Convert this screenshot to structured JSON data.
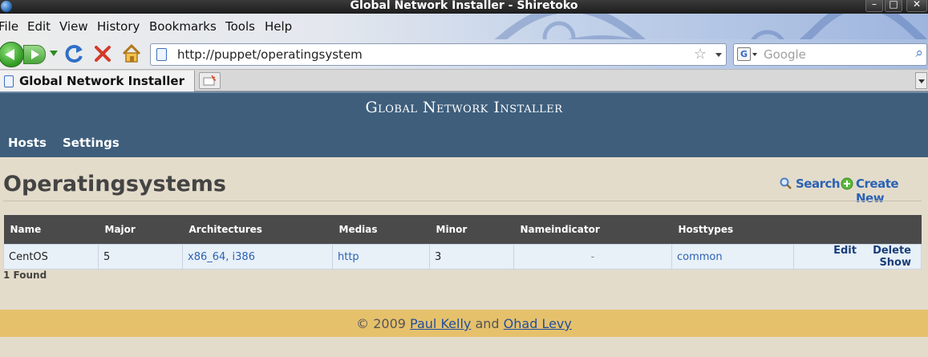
{
  "window": {
    "title": "Global Network Installer - Shiretoko"
  },
  "menu": [
    "File",
    "Edit",
    "View",
    "History",
    "Bookmarks",
    "Tools",
    "Help"
  ],
  "toolbar": {
    "url": "http://puppet/operatingsystem",
    "search_placeholder": "Google",
    "search_engine_glyph": "G"
  },
  "tab": {
    "label": "Global Network Installer"
  },
  "site": {
    "title": "Global Network Installer",
    "nav": [
      "Hosts",
      "Settings"
    ]
  },
  "page": {
    "heading": "Operatingsystems",
    "search_label": "Search",
    "create_label": "Create New",
    "found": "1 Found"
  },
  "table": {
    "headers": [
      "Name",
      "Major",
      "Architectures",
      "Medias",
      "Minor",
      "Nameindicator",
      "Hosttypes",
      ""
    ],
    "rows": [
      {
        "name": "CentOS",
        "major": "5",
        "architectures": "x86_64, i386",
        "medias": "http",
        "minor": "3",
        "nameindicator": "-",
        "hosttypes": "common",
        "actions": [
          "Edit",
          "Delete",
          "Show"
        ]
      }
    ]
  },
  "footer": {
    "prefix": "© 2009",
    "author1": "Paul Kelly",
    "and": "and",
    "author2": "Ohad Levy"
  },
  "colors": {
    "header_bg": "#3e5e7c",
    "page_bg": "#e4dccb",
    "footer_bg": "#e6c16c",
    "link": "#2b62b4",
    "table_header": "#4a4a4a"
  }
}
